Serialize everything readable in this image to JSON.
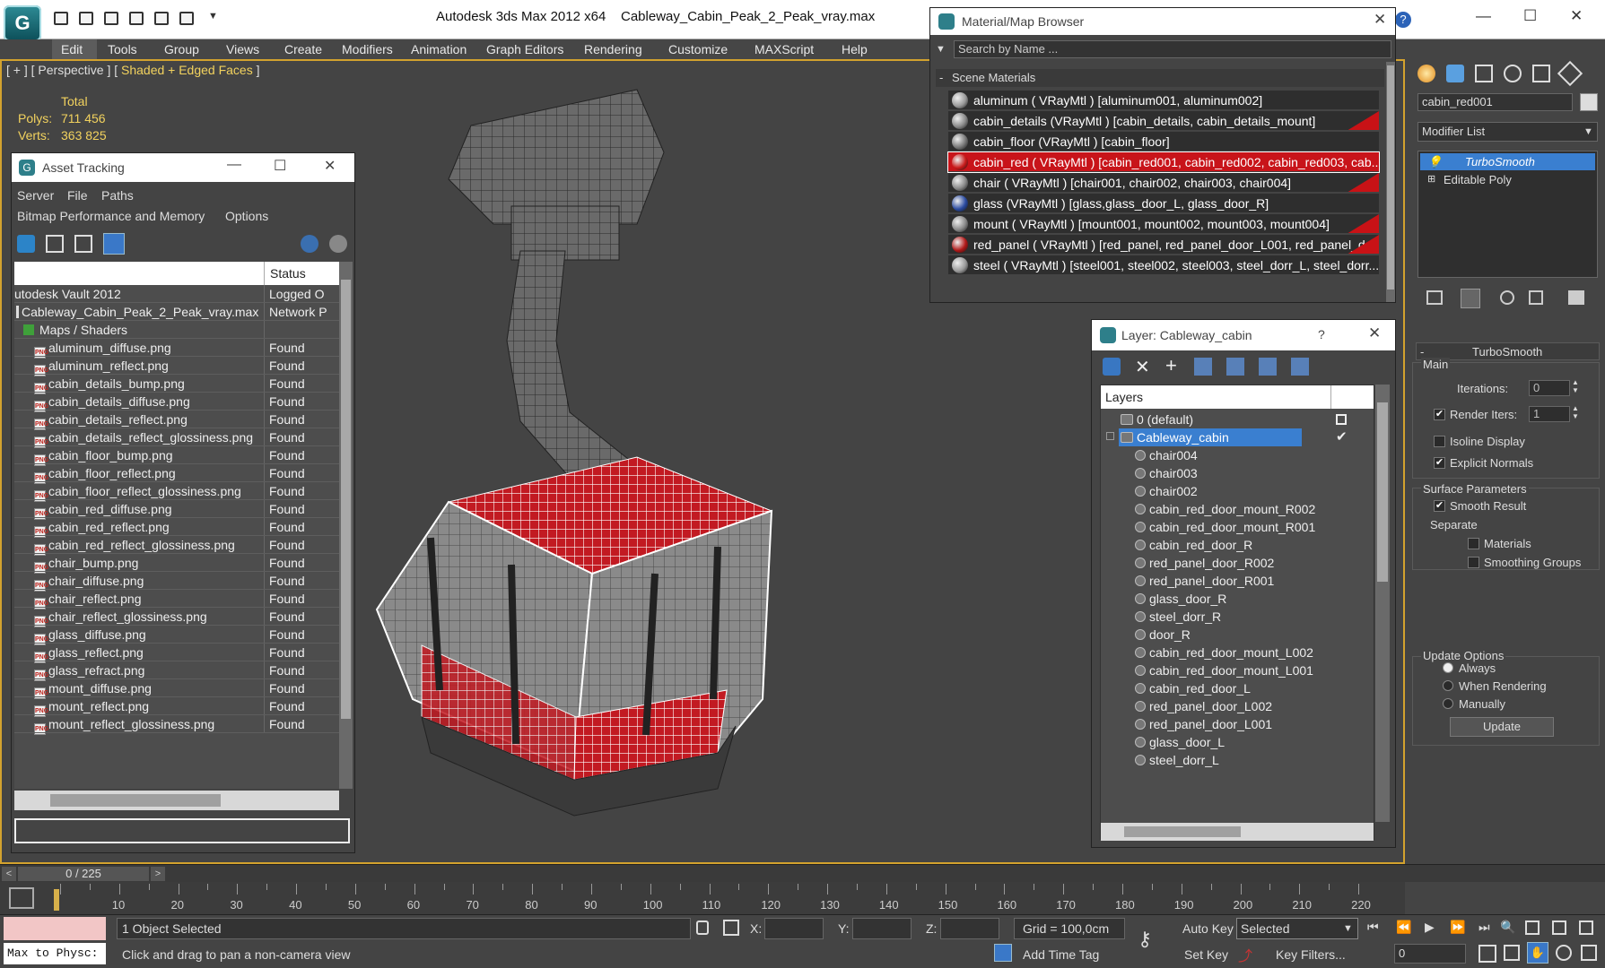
{
  "title_bar": {
    "app_title": "Autodesk 3ds Max  2012 x64",
    "file_title": "Cableway_Cabin_Peak_2_Peak_vray.max"
  },
  "menu": [
    "Edit",
    "Tools",
    "Group",
    "Views",
    "Create",
    "Modifiers",
    "Animation",
    "Graph Editors",
    "Rendering",
    "Customize",
    "MAXScript",
    "Help"
  ],
  "viewport": {
    "label_prefix": "[ + ] [ Perspective ] [ ",
    "label_mode": "Shaded + Edged Faces",
    "label_suffix": " ]",
    "stats_total": "Total",
    "polys_label": "Polys:",
    "polys_value": "711 456",
    "verts_label": "Verts:",
    "verts_value": "363 825"
  },
  "asset_tracking": {
    "title": "Asset Tracking",
    "menu1": [
      "Server",
      "File",
      "Paths"
    ],
    "menu2": [
      "Bitmap Performance and Memory",
      "Options"
    ],
    "col_status": "Status",
    "rows": [
      {
        "name": "utodesk Vault 2012",
        "status": "Logged O",
        "type": "vault"
      },
      {
        "name": "Cableway_Cabin_Peak_2_Peak_vray.max",
        "status": "Network P",
        "type": "file"
      },
      {
        "name": "Maps / Shaders",
        "status": "",
        "type": "folder"
      },
      {
        "name": "aluminum_diffuse.png",
        "status": "Found",
        "type": "png"
      },
      {
        "name": "aluminum_reflect.png",
        "status": "Found",
        "type": "png"
      },
      {
        "name": "cabin_details_bump.png",
        "status": "Found",
        "type": "png"
      },
      {
        "name": "cabin_details_diffuse.png",
        "status": "Found",
        "type": "png"
      },
      {
        "name": "cabin_details_reflect.png",
        "status": "Found",
        "type": "png"
      },
      {
        "name": "cabin_details_reflect_glossiness.png",
        "status": "Found",
        "type": "png"
      },
      {
        "name": "cabin_floor_bump.png",
        "status": "Found",
        "type": "png"
      },
      {
        "name": "cabin_floor_reflect.png",
        "status": "Found",
        "type": "png"
      },
      {
        "name": "cabin_floor_reflect_glossiness.png",
        "status": "Found",
        "type": "png"
      },
      {
        "name": "cabin_red_diffuse.png",
        "status": "Found",
        "type": "png"
      },
      {
        "name": "cabin_red_reflect.png",
        "status": "Found",
        "type": "png"
      },
      {
        "name": "cabin_red_reflect_glossiness.png",
        "status": "Found",
        "type": "png"
      },
      {
        "name": "chair_bump.png",
        "status": "Found",
        "type": "png"
      },
      {
        "name": "chair_diffuse.png",
        "status": "Found",
        "type": "png"
      },
      {
        "name": "chair_reflect.png",
        "status": "Found",
        "type": "png"
      },
      {
        "name": "chair_reflect_glossiness.png",
        "status": "Found",
        "type": "png"
      },
      {
        "name": "glass_diffuse.png",
        "status": "Found",
        "type": "png"
      },
      {
        "name": "glass_reflect.png",
        "status": "Found",
        "type": "png"
      },
      {
        "name": "glass_refract.png",
        "status": "Found",
        "type": "png"
      },
      {
        "name": "mount_diffuse.png",
        "status": "Found",
        "type": "png"
      },
      {
        "name": "mount_reflect.png",
        "status": "Found",
        "type": "png"
      },
      {
        "name": "mount_reflect_glossiness.png",
        "status": "Found",
        "type": "png"
      }
    ],
    "png_badge": "PNG"
  },
  "material_browser": {
    "title": "Material/Map Browser",
    "search_placeholder": "Search by Name ...",
    "group": "Scene Materials",
    "group_toggle": "-",
    "items": [
      {
        "text": "aluminum  ( VRayMtl ) [aluminum001, aluminum002]",
        "flag": false,
        "selected": false,
        "swatch": "#999999"
      },
      {
        "text": "cabin_details  (VRayMtl ) [cabin_details, cabin_details_mount]",
        "flag": true,
        "selected": false,
        "swatch": "#888888"
      },
      {
        "text": "cabin_floor  (VRayMtl ) [cabin_floor]",
        "flag": false,
        "selected": false,
        "swatch": "#777777"
      },
      {
        "text": "cabin_red  ( VRayMtl ) [cabin_red001, cabin_red002, cabin_red003, cab...",
        "flag": false,
        "selected": true,
        "swatch": "#c81a1a"
      },
      {
        "text": "chair  ( VRayMtl ) [chair001, chair002, chair003, chair004]",
        "flag": true,
        "selected": false,
        "swatch": "#888888"
      },
      {
        "text": "glass  (VRayMtl ) [glass,glass_door_L, glass_door_R]",
        "flag": false,
        "selected": false,
        "swatch": "#2a4aa0"
      },
      {
        "text": "mount  ( VRayMtl ) [mount001, mount002, mount003, mount004]",
        "flag": true,
        "selected": false,
        "swatch": "#888888"
      },
      {
        "text": "red_panel  ( VRayMtl ) [red_panel, red_panel_door_L001, red_panel_do...",
        "flag": true,
        "selected": false,
        "swatch": "#b01818"
      },
      {
        "text": "steel  ( VRayMtl ) [steel001, steel002, steel003, steel_dorr_L, steel_dorr...",
        "flag": false,
        "selected": false,
        "swatch": "#999999"
      }
    ]
  },
  "layer_explorer": {
    "title": "Layer: Cableway_cabin",
    "help": "?",
    "column": "Layers",
    "rows": [
      {
        "name": "0 (default)",
        "level": 0,
        "kind": "layer"
      },
      {
        "name": "Cableway_cabin",
        "level": 0,
        "kind": "layer",
        "selected": true
      },
      {
        "name": "chair004",
        "level": 1,
        "kind": "object"
      },
      {
        "name": "chair003",
        "level": 1,
        "kind": "object"
      },
      {
        "name": "chair002",
        "level": 1,
        "kind": "object"
      },
      {
        "name": "cabin_red_door_mount_R002",
        "level": 1,
        "kind": "object"
      },
      {
        "name": "cabin_red_door_mount_R001",
        "level": 1,
        "kind": "object"
      },
      {
        "name": "cabin_red_door_R",
        "level": 1,
        "kind": "object"
      },
      {
        "name": "red_panel_door_R002",
        "level": 1,
        "kind": "object"
      },
      {
        "name": "red_panel_door_R001",
        "level": 1,
        "kind": "object"
      },
      {
        "name": "glass_door_R",
        "level": 1,
        "kind": "object"
      },
      {
        "name": "steel_dorr_R",
        "level": 1,
        "kind": "object"
      },
      {
        "name": "door_R",
        "level": 1,
        "kind": "object"
      },
      {
        "name": "cabin_red_door_mount_L002",
        "level": 1,
        "kind": "object"
      },
      {
        "name": "cabin_red_door_mount_L001",
        "level": 1,
        "kind": "object"
      },
      {
        "name": "cabin_red_door_L",
        "level": 1,
        "kind": "object"
      },
      {
        "name": "red_panel_door_L002",
        "level": 1,
        "kind": "object"
      },
      {
        "name": "red_panel_door_L001",
        "level": 1,
        "kind": "object"
      },
      {
        "name": "glass_door_L",
        "level": 1,
        "kind": "object"
      },
      {
        "name": "steel_dorr_L",
        "level": 1,
        "kind": "object"
      }
    ]
  },
  "command_panel": {
    "object_name": "cabin_red001",
    "modifier_list": "Modifier List",
    "stack": [
      {
        "name": "TurboSmooth",
        "selected": true
      },
      {
        "name": "Editable Poly",
        "selected": false
      }
    ],
    "rollout_title": "TurboSmooth",
    "rollout_toggle": "-",
    "main_label": "Main",
    "iterations_label": "Iterations:",
    "iterations_value": "0",
    "render_iters_label": "Render Iters:",
    "render_iters_value": "1",
    "render_iters_checked": true,
    "isoline_label": "Isoline Display",
    "isoline_checked": false,
    "explicit_normals_label": "Explicit Normals",
    "explicit_normals_checked": true,
    "surface_params_label": "Surface Parameters",
    "smooth_result_label": "Smooth Result",
    "smooth_result_checked": true,
    "separate_label": "Separate",
    "materials_label": "Materials",
    "smoothing_groups_label": "Smoothing Groups",
    "update_options_label": "Update Options",
    "always_label": "Always",
    "when_rendering_label": "When Rendering",
    "manually_label": "Manually",
    "update_button": "Update",
    "check_mark": "✔"
  },
  "timeline": {
    "frame_counter": "0 / 225",
    "ticks": [
      "10",
      "20",
      "30",
      "40",
      "50",
      "60",
      "70",
      "80",
      "90",
      "100",
      "110",
      "120",
      "130",
      "140",
      "150",
      "160",
      "170",
      "180",
      "190",
      "200",
      "210",
      "220"
    ]
  },
  "status_bar": {
    "maxscript_text": "Max to Physc:",
    "selection": "1 Object Selected",
    "prompt": "Click and drag to pan a non-camera view",
    "x_label": "X:",
    "y_label": "Y:",
    "z_label": "Z:",
    "grid": "Grid = 100,0cm",
    "add_time_tag": "Add Time Tag",
    "auto_key": "Auto Key",
    "set_key": "Set Key",
    "selected_option": "Selected",
    "key_filters": "Key Filters...",
    "frame_value": "0"
  }
}
